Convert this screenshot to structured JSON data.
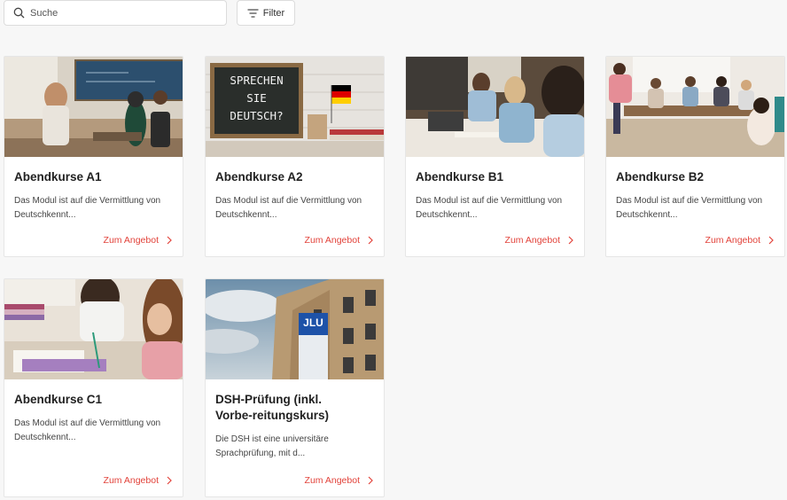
{
  "search": {
    "placeholder": "Suche",
    "icon": "search-icon"
  },
  "filter": {
    "label": "Filter",
    "icon": "filter-icon"
  },
  "colors": {
    "accent": "#e2433b",
    "background": "#f7f7f7"
  },
  "cards": [
    {
      "title": "Abendkurse A1",
      "description": "Das Modul ist auf die Vermittlung von Deutschkennt...",
      "link": "Zum Angebot"
    },
    {
      "title": "Abendkurse A2",
      "description": "Das Modul ist auf die Vermittlung von Deutschkennt...",
      "link": "Zum Angebot",
      "image_text": [
        "SPRECHEN",
        "SIE",
        "DEUTSCH?"
      ]
    },
    {
      "title": "Abendkurse B1",
      "description": "Das Modul ist auf die Vermittlung von Deutschkennt...",
      "link": "Zum Angebot"
    },
    {
      "title": "Abendkurse B2",
      "description": "Das Modul ist auf die Vermittlung von Deutschkennt...",
      "link": "Zum Angebot"
    },
    {
      "title": "Abendkurse C1",
      "description": "Das Modul ist auf die Vermittlung von Deutschkennt...",
      "link": "Zum Angebot"
    },
    {
      "title": "DSH-Prüfung (inkl. Vorbe-reitungskurs)",
      "description": "Die DSH ist eine universitäre Sprachprüfung, mit d...",
      "link": "Zum Angebot",
      "image_text": [
        "JLU"
      ]
    }
  ]
}
